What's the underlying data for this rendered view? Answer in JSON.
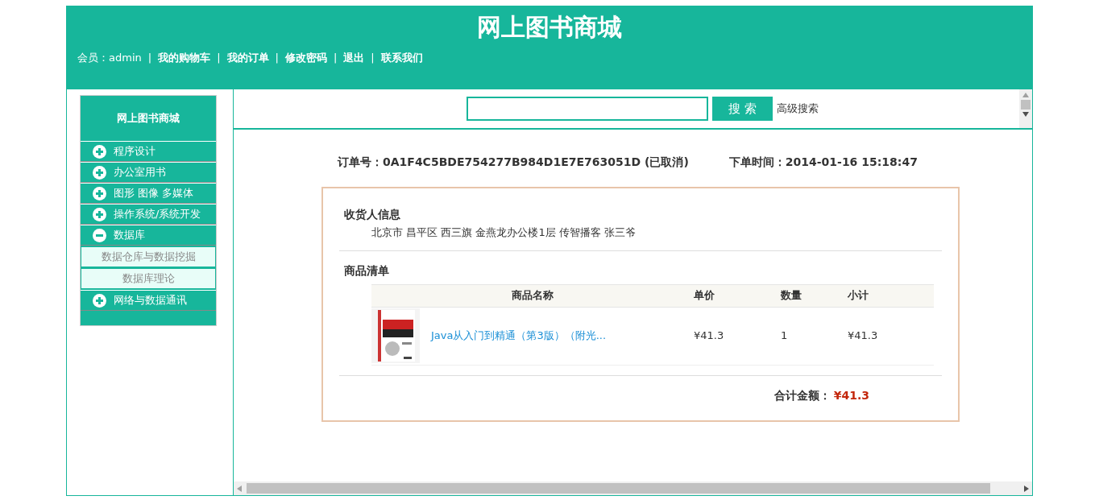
{
  "header": {
    "title": "网上图书商城",
    "member": "会员：admin",
    "links": [
      {
        "separator": "|",
        "label": "我的购物车"
      },
      {
        "separator": "|",
        "label": "我的订单"
      },
      {
        "separator": "|",
        "label": "修改密码"
      },
      {
        "separator": "|",
        "label": "退出"
      },
      {
        "separator": "|",
        "label": "联系我们"
      }
    ]
  },
  "sidebar": {
    "title": "网上图书商城",
    "categories": [
      {
        "label": "程序设计",
        "expanded": false
      },
      {
        "label": "办公室用书",
        "expanded": false
      },
      {
        "label": "图形 图像 多媒体",
        "expanded": false
      },
      {
        "label": "操作系统/系统开发",
        "expanded": false
      },
      {
        "label": "数据库",
        "expanded": true,
        "children": [
          {
            "label": "数据仓库与数据挖掘"
          },
          {
            "label": "数据库理论"
          }
        ]
      },
      {
        "label": "网络与数据通讯",
        "expanded": false
      }
    ]
  },
  "search": {
    "button": "搜 索",
    "advanced": "高级搜索"
  },
  "order": {
    "number": "订单号：0A1F4C5BDE754277B984D1E7E763051D (已取消)",
    "time": "下单时间：2014-01-16 15:18:47",
    "consignee_title": "收货人信息",
    "address": "北京市 昌平区 西三旗 金燕龙办公楼1层 传智播客 张三爷",
    "items_title": "商品清单",
    "columns": [
      "商品名称",
      "单价",
      "数量",
      "小计"
    ],
    "rows": [
      {
        "name": "Java从入门到精通（第3版）（附光...",
        "price": "¥41.3",
        "quantity": "1",
        "subtotal": "¥41.3"
      }
    ],
    "total_label": "合计金额：",
    "total": "¥41.3"
  }
}
